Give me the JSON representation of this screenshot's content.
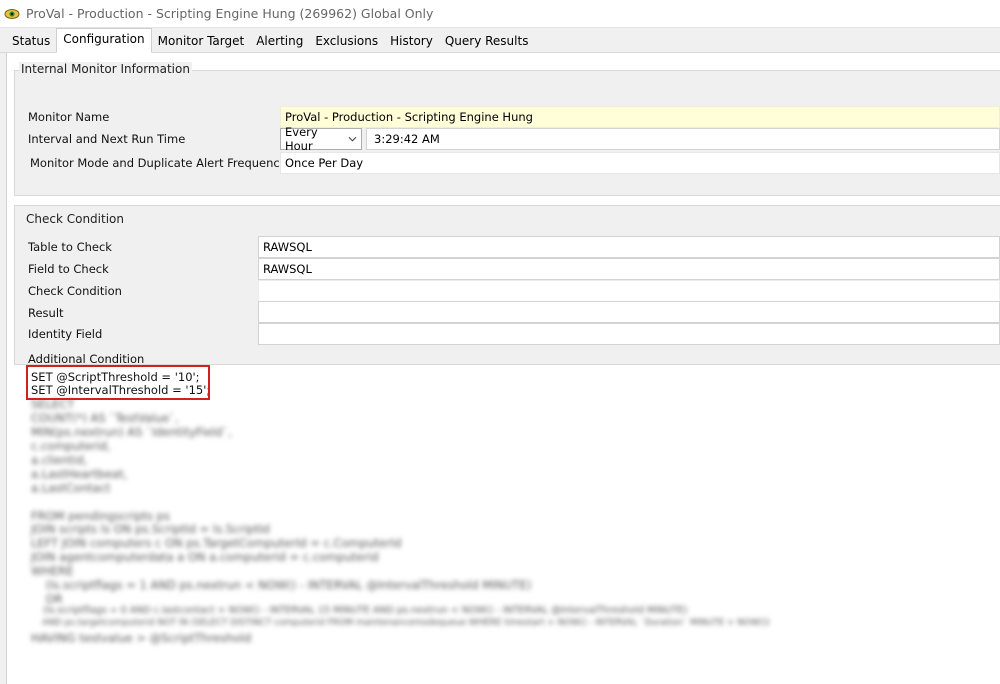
{
  "window": {
    "title": "ProVal - Production - Scripting Engine Hung (269962) Global Only",
    "icon": "monitor-eye-icon"
  },
  "tabs": [
    {
      "label": "Status"
    },
    {
      "label": "Configuration",
      "active": true
    },
    {
      "label": "Monitor Target"
    },
    {
      "label": "Alerting"
    },
    {
      "label": "Exclusions"
    },
    {
      "label": "History"
    },
    {
      "label": "Query Results"
    }
  ],
  "internal_monitor": {
    "group_label": "Internal Monitor Information",
    "monitor_name_label": "Monitor Name",
    "monitor_name_value": "ProVal - Production - Scripting Engine Hung",
    "interval_label": "Interval and Next Run Time",
    "interval_value": "Every Hour",
    "next_run_value": "3:29:42 AM",
    "mode_label": "Monitor Mode and Duplicate Alert Frequency",
    "mode_value": "Once Per Day"
  },
  "check_condition": {
    "group_label": "Check Condition",
    "table_label": "Table to Check",
    "table_value": "RAWSQL",
    "field_label": "Field to Check",
    "field_value": "RAWSQL",
    "condition_label": "Check Condition",
    "condition_value": "",
    "result_label": "Result",
    "result_value": "",
    "identity_label": "Identity Field",
    "identity_value": "",
    "additional_label": "Additional Condition"
  },
  "sql": {
    "visible_lines": [
      "SET @ScriptThreshold = '10';",
      "SET @IntervalThreshold = '15';"
    ],
    "blurred_lines": [
      "SELECT",
      "COUNT(*) AS `TestValue`,",
      "MIN(ps.nextrun) AS `IdentityField`,",
      "c.computerid,",
      "a.clientid,",
      "a.LastHeartbeat,",
      "a.LastContact",
      "",
      "FROM pendingscripts ps",
      "JOIN scripts ls ON ps.ScriptId = ls.ScriptId",
      "LEFT JOIN computers c ON ps.TargetComputerId = c.ComputerId",
      "JOIN agentcomputerdata a ON a.computerid = c.computerid",
      "WHERE",
      "    (ls.scriptflags = 1 AND ps.nextrun < NOW() - INTERVAL @IntervalThreshold MINUTE)",
      "    OR",
      "    (ls.scriptflags = 0 AND c.lastcontact > NOW() - INTERVAL 15 MINUTE AND ps.nextrun < NOW() - INTERVAL @IntervalThreshold MINUTE)",
      "    AND ps.targetcomputerid NOT IN (SELECT DISTINCT computerid FROM maintenancemodequeue WHERE timestart > NOW() - INTERVAL `Duration` MINUTE + NOW())",
      "HAVING testvalue > @ScriptThreshold"
    ]
  }
}
